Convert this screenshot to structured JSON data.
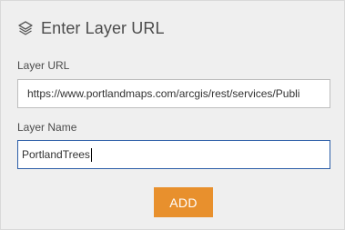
{
  "header": {
    "icon": "layers-icon",
    "title": "Enter Layer URL"
  },
  "form": {
    "url_label": "Layer URL",
    "url_value": "https://www.portlandmaps.com/arcgis/rest/services/Publi",
    "name_label": "Layer Name",
    "name_value": "PortlandTrees"
  },
  "actions": {
    "add_label": "ADD"
  },
  "colors": {
    "accent": "#e8902d",
    "focus_border": "#2c5ea8",
    "panel_bg": "#efefef"
  }
}
